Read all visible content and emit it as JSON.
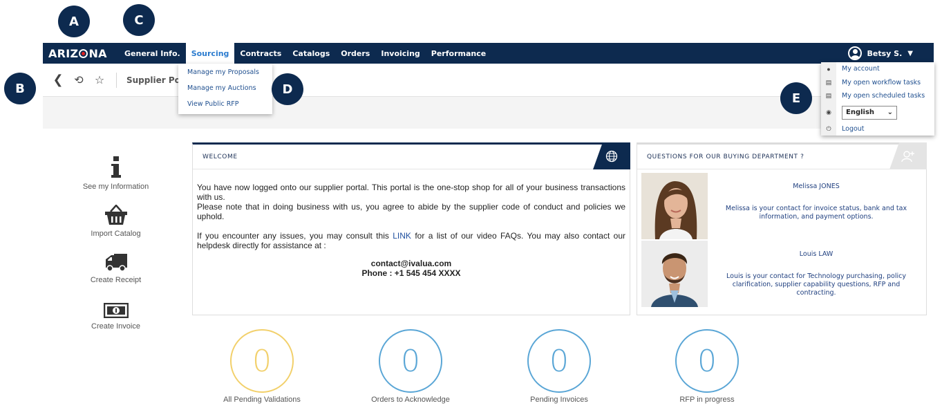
{
  "callouts": [
    "A",
    "B",
    "C",
    "D",
    "E"
  ],
  "brand": {
    "logo_left": "ARIZ",
    "logo_right": "NA"
  },
  "nav": {
    "items": [
      "General Info.",
      "Sourcing",
      "Contracts",
      "Catalogs",
      "Orders",
      "Invoicing",
      "Performance"
    ],
    "active": "Sourcing"
  },
  "user": {
    "name": "Betsy S."
  },
  "toolbar": {
    "title": "Supplier Port"
  },
  "sourcing_menu": [
    "Manage my Proposals",
    "Manage my Auctions",
    "View Public RFP"
  ],
  "user_menu": {
    "items": [
      "My account",
      "My open workflow tasks",
      "My open scheduled tasks"
    ],
    "language": "English",
    "logout": "Logout"
  },
  "shortcuts": [
    "See my Information",
    "Import Catalog",
    "Create Receipt",
    "Create Invoice"
  ],
  "welcome": {
    "title": "WELCOME",
    "para1": "You have now logged onto our supplier portal. This portal is the one-stop shop for all of your business transactions with us.",
    "para2": "Please note that in doing business with us, you agree to abide by the supplier code of conduct and policies we uphold.",
    "para3_before": "If you encounter any issues, you may consult this ",
    "link": "LINK",
    "para3_after": " for a list of our video FAQs. You may also contact our helpdesk directly for assistance at :",
    "email": "contact@ivalua.com",
    "phone": "Phone : +1 545 454 XXXX"
  },
  "questions": {
    "title": "QUESTIONS FOR OUR BUYING DEPARTMENT ?",
    "contacts": [
      {
        "name": "Melissa JONES",
        "desc": "Melissa is your contact for invoice status, bank and tax information, and payment options."
      },
      {
        "name": "Louis LAW",
        "desc": "Louis is your contact for Technology purchasing, policy clarification, supplier capability questions, RFP and contracting."
      }
    ]
  },
  "kpis": [
    {
      "value": "0",
      "label": "All Pending Validations",
      "color": "#f2d06b"
    },
    {
      "value": "0",
      "label": "Orders to Acknowledge",
      "color": "#5aa6d6"
    },
    {
      "value": "0",
      "label": "Pending Invoices",
      "color": "#5aa6d6"
    },
    {
      "value": "0",
      "label": "RFP in progress",
      "color": "#5aa6d6"
    }
  ],
  "colors": {
    "navy": "#0d2a4f",
    "accent": "#2b7ccf",
    "link": "#1f4f8f"
  }
}
